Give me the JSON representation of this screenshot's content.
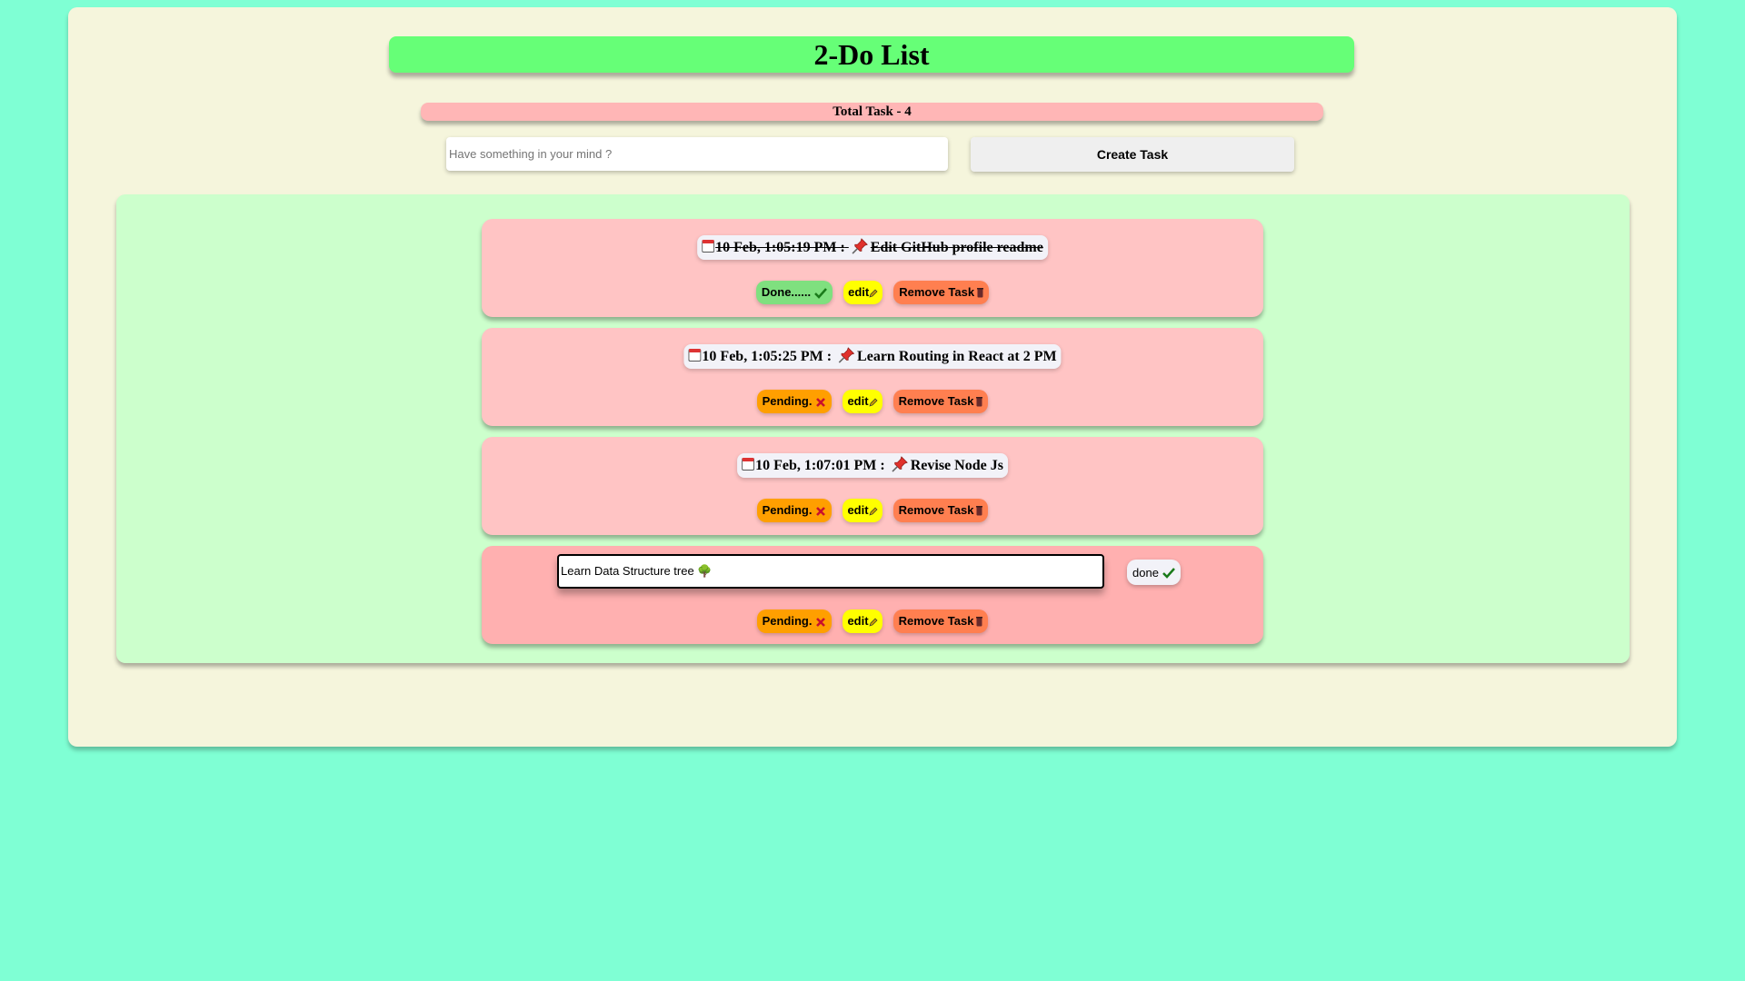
{
  "app": {
    "title": "2-Do List",
    "total": "Total Task - 4"
  },
  "form": {
    "placeholder": "Have something in your mind ?",
    "value": "",
    "create_label": "Create Task"
  },
  "tasks": [
    {
      "timestamp": "10 Feb, 1:05:19 PM :",
      "text": "Edit GitHub profile readme",
      "status_label": "Done......",
      "status": "done",
      "edit_label": "edit",
      "remove_label": "Remove Task"
    },
    {
      "timestamp": "10 Feb, 1:05:25 PM :",
      "text": "Learn Routing in React at 2 PM",
      "status_label": "Pending.",
      "status": "pending",
      "edit_label": "edit",
      "remove_label": "Remove Task"
    },
    {
      "timestamp": "10 Feb, 1:07:01 PM :",
      "text": "Revise Node Js",
      "status_label": "Pending.",
      "status": "pending",
      "edit_label": "edit",
      "remove_label": "Remove Task"
    },
    {
      "edit_value": "Learn Data Structure tree 🌳",
      "done_label": "done",
      "status_label": "Pending.",
      "status": "pending",
      "edit_label": "edit",
      "remove_label": "Remove Task"
    }
  ],
  "icons": {
    "calendar": "calendar-icon",
    "pin": "pushpin-icon",
    "check": "check-icon",
    "cross": "cross-icon",
    "pencil": "pencil-icon",
    "trash": "trash-icon"
  },
  "colors": {
    "page_background": "#7fffd4",
    "app_background": "#f5f5dc",
    "title_bar": "#66ff77",
    "total_bar": "#ffb6b6",
    "list_background": "#ccffcc",
    "card": "#ffc4c4",
    "done_status": "#7fe07f",
    "pending_status": "#ff9f00",
    "edit_button": "#ffff00",
    "remove_button": "#ff7f50"
  }
}
